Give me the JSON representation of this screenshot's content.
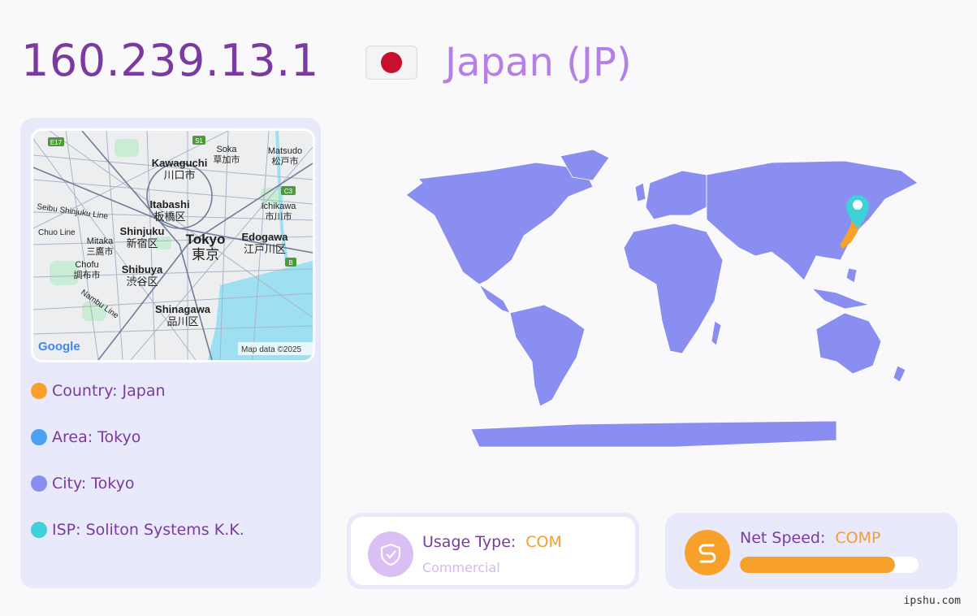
{
  "header": {
    "ip": "160.239.13.1",
    "country_title": "Japan (JP)",
    "flag_icon": "japan-flag-icon"
  },
  "mini_map": {
    "labels": [
      {
        "text": "E17"
      },
      {
        "text": "S1"
      },
      {
        "text": "Soka"
      },
      {
        "text": "草加市"
      },
      {
        "text": "Matsudo"
      },
      {
        "text": "松戸市"
      },
      {
        "text": "Kawaguchi"
      },
      {
        "text": "川口市"
      },
      {
        "text": "C3"
      },
      {
        "text": "Itabashi"
      },
      {
        "text": "板橋区"
      },
      {
        "text": "Ichikawa"
      },
      {
        "text": "市川市"
      },
      {
        "text": "Seibu Shinjuku Line"
      },
      {
        "text": "Chuo Line"
      },
      {
        "text": "Shinjuku"
      },
      {
        "text": "新宿区"
      },
      {
        "text": "Tokyo"
      },
      {
        "text": "東京"
      },
      {
        "text": "Edogawa"
      },
      {
        "text": "江戸川区"
      },
      {
        "text": "Mitaka"
      },
      {
        "text": "三鷹市"
      },
      {
        "text": "B"
      },
      {
        "text": "Chofu"
      },
      {
        "text": "調布市"
      },
      {
        "text": "Shibuya"
      },
      {
        "text": "渋谷区"
      },
      {
        "text": "Nambu Line"
      },
      {
        "text": "Shinagawa"
      },
      {
        "text": "品川区"
      }
    ],
    "logo": "Google",
    "attribution": "Map data ©2025"
  },
  "info": {
    "country": "Country: Japan",
    "area": "Area: Tokyo",
    "city": "City: Tokyo",
    "isp": "ISP: Soliton Systems K.K."
  },
  "colors": {
    "ip_text": "#7b3aa0",
    "country_title": "#b57fe6",
    "map_land": "#8a8ef0",
    "highlight": "#f7a12a",
    "pin": "#3fd0d8",
    "dot_country": "#f7a12a",
    "dot_area": "#4aa3f0",
    "dot_city": "#8a8ef0",
    "dot_isp": "#3fd0d8"
  },
  "usage": {
    "label": "Usage Type:",
    "value": "COM",
    "description": "Commercial",
    "icon": "shield-check-icon"
  },
  "speed": {
    "label": "Net Speed:",
    "value": "COMP",
    "progress": 0.87,
    "icon": "speed-route-icon"
  },
  "world_map": {
    "pin_icon": "location-pin-icon",
    "highlighted_country": "Japan"
  },
  "footer": {
    "site": "ipshu.com"
  }
}
